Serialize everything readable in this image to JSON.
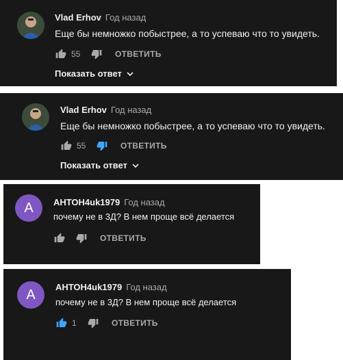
{
  "colors": {
    "card_bg": "#181818",
    "text": "#f1f1f1",
    "muted": "#aaaaaa",
    "like_active": "#3ea6ff",
    "avatar_letter_bg": "#7e57c2"
  },
  "comments": [
    {
      "author": "Vlad Erhov",
      "time": "Год назад",
      "text": "Еще бы немножко побыстрее, а то успеваю что то увидеть.",
      "likes": "55",
      "reply_label": "ОТВЕТИТЬ",
      "show_replies_label": "Показать ответ",
      "avatar_icon": "user-photo-avatar"
    },
    {
      "author": "Vlad Erhov",
      "time": "Год назад",
      "text": "Еще бы немножко побыстрее, а то успеваю что то увидеть.",
      "likes": "55",
      "reply_label": "ОТВЕТИТЬ",
      "show_replies_label": "Показать ответ",
      "avatar_icon": "user-photo-avatar",
      "dislike_active": true
    },
    {
      "author": "АНТОН4uk1979",
      "time": "Год назад",
      "text": "почему не в 3Д? В нем проще всё делается",
      "avatar_letter": "А",
      "reply_label": "ОТВЕТИТЬ"
    },
    {
      "author": "АНТОН4uk1979",
      "time": "Год назад",
      "text": "почему не в 3Д? В нем проще всё делается",
      "avatar_letter": "А",
      "likes": "1",
      "reply_label": "ОТВЕТИТЬ",
      "like_active": true
    }
  ]
}
